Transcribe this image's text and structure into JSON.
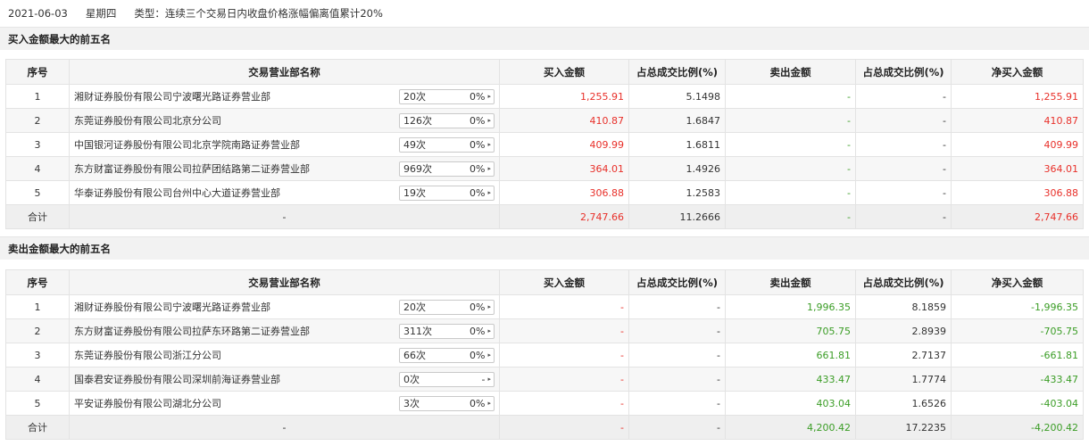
{
  "header": {
    "date": "2021-06-03",
    "weekday": "星期四",
    "type_text": "类型：连续三个交易日内收盘价格涨幅偏离值累计20%"
  },
  "columns": [
    "序号",
    "交易营业部名称",
    "买入金额",
    "占总成交比例(%)",
    "卖出金额",
    "占总成交比例(%)",
    "净买入金额"
  ],
  "buy_section": {
    "title": "买入金额最大的前五名",
    "rows": [
      {
        "idx": "1",
        "name": "湘财证券股份有限公司宁波曙光路证券营业部",
        "count": "20次",
        "pct_tag": "0%",
        "arrow": "▸",
        "buy": "1,255.91",
        "buy_ratio": "5.1498",
        "sell": "-",
        "sell_ratio": "-",
        "net": "1,255.91"
      },
      {
        "idx": "2",
        "name": "东莞证券股份有限公司北京分公司",
        "count": "126次",
        "pct_tag": "0%",
        "arrow": "▸",
        "buy": "410.87",
        "buy_ratio": "1.6847",
        "sell": "-",
        "sell_ratio": "-",
        "net": "410.87"
      },
      {
        "idx": "3",
        "name": "中国银河证券股份有限公司北京学院南路证券营业部",
        "count": "49次",
        "pct_tag": "0%",
        "arrow": "▸",
        "buy": "409.99",
        "buy_ratio": "1.6811",
        "sell": "-",
        "sell_ratio": "-",
        "net": "409.99"
      },
      {
        "idx": "4",
        "name": "东方财富证券股份有限公司拉萨团结路第二证券营业部",
        "count": "969次",
        "pct_tag": "0%",
        "arrow": "▸",
        "buy": "364.01",
        "buy_ratio": "1.4926",
        "sell": "-",
        "sell_ratio": "-",
        "net": "364.01"
      },
      {
        "idx": "5",
        "name": "华泰证券股份有限公司台州中心大道证券营业部",
        "count": "19次",
        "pct_tag": "0%",
        "arrow": "▸",
        "buy": "306.88",
        "buy_ratio": "1.2583",
        "sell": "-",
        "sell_ratio": "-",
        "net": "306.88"
      }
    ],
    "total": {
      "label": "合计",
      "name": "-",
      "buy": "2,747.66",
      "buy_ratio": "11.2666",
      "sell": "-",
      "sell_ratio": "-",
      "net": "2,747.66"
    }
  },
  "sell_section": {
    "title": "卖出金额最大的前五名",
    "rows": [
      {
        "idx": "1",
        "name": "湘财证券股份有限公司宁波曙光路证券营业部",
        "count": "20次",
        "pct_tag": "0%",
        "arrow": "▸",
        "buy": "-",
        "buy_ratio": "-",
        "sell": "1,996.35",
        "sell_ratio": "8.1859",
        "net": "-1,996.35"
      },
      {
        "idx": "2",
        "name": "东方财富证券股份有限公司拉萨东环路第二证券营业部",
        "count": "311次",
        "pct_tag": "0%",
        "arrow": "▸",
        "buy": "-",
        "buy_ratio": "-",
        "sell": "705.75",
        "sell_ratio": "2.8939",
        "net": "-705.75"
      },
      {
        "idx": "3",
        "name": "东莞证券股份有限公司浙江分公司",
        "count": "66次",
        "pct_tag": "0%",
        "arrow": "▸",
        "buy": "-",
        "buy_ratio": "-",
        "sell": "661.81",
        "sell_ratio": "2.7137",
        "net": "-661.81"
      },
      {
        "idx": "4",
        "name": "国泰君安证券股份有限公司深圳前海证券营业部",
        "count": "0次",
        "pct_tag": "-",
        "arrow": "▸",
        "buy": "-",
        "buy_ratio": "-",
        "sell": "433.47",
        "sell_ratio": "1.7774",
        "net": "-433.47"
      },
      {
        "idx": "5",
        "name": "平安证券股份有限公司湖北分公司",
        "count": "3次",
        "pct_tag": "0%",
        "arrow": "▸",
        "buy": "-",
        "buy_ratio": "-",
        "sell": "403.04",
        "sell_ratio": "1.6526",
        "net": "-403.04"
      }
    ],
    "total": {
      "label": "合计",
      "name": "-",
      "buy": "-",
      "buy_ratio": "-",
      "sell": "4,200.42",
      "sell_ratio": "17.2235",
      "net": "-4,200.42"
    }
  },
  "colors": {
    "positive": "#e8302a",
    "negative": "#3b9d26",
    "header_bg": "#f5f5f5"
  }
}
